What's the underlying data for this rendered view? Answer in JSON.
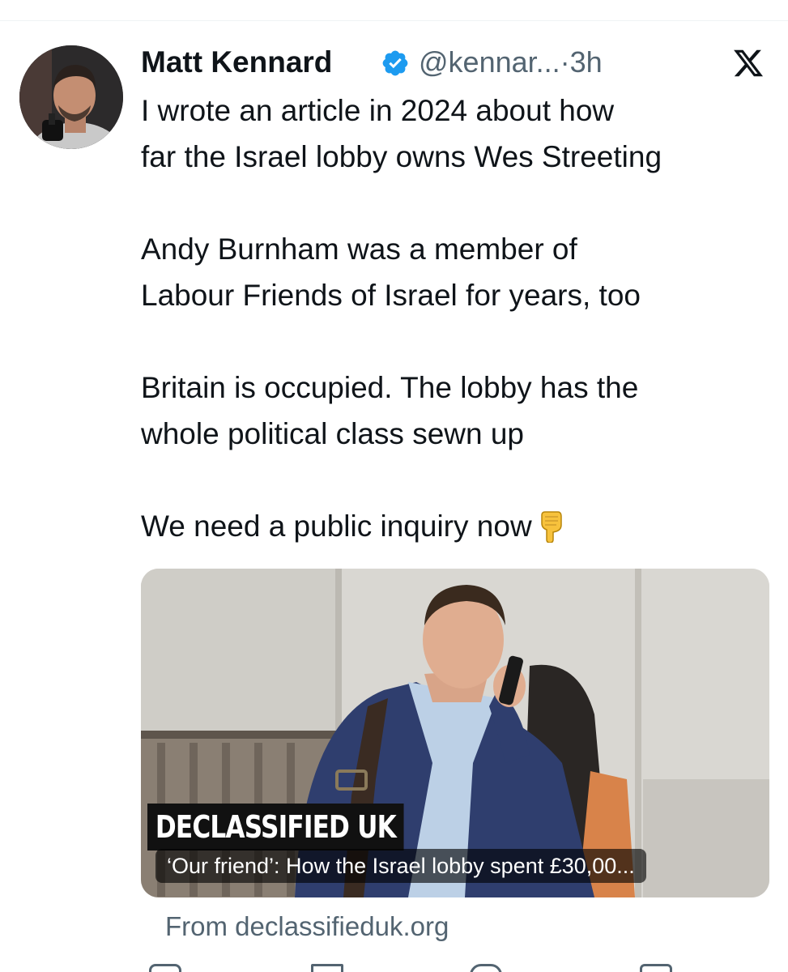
{
  "tweet": {
    "author_name": "Matt Kennard",
    "handle": "@kennar...",
    "separator": "·",
    "time": "3h",
    "verified": true,
    "platform_icon": "x-logo-icon",
    "paragraphs": [
      [
        "I wrote an article in 2024 about how",
        "far the Israel lobby owns Wes Streeting"
      ],
      [
        "Andy Burnham was a member of",
        "Labour Friends of Israel for years, too"
      ],
      [
        "Britain is occupied. The lobby has the",
        "whole political class sewn up"
      ],
      [
        "We need a public inquiry now"
      ]
    ],
    "emoji": "backhand-index-pointing-down"
  },
  "link_card": {
    "brand": "DECLASSIFIED UK",
    "title": "‘Our friend’: How the Israel lobby spent £30,00...",
    "source": "From declassifieduk.org"
  },
  "colors": {
    "text": "#0f1419",
    "secondary": "#536471",
    "verified_blue": "#1d9bf0"
  }
}
